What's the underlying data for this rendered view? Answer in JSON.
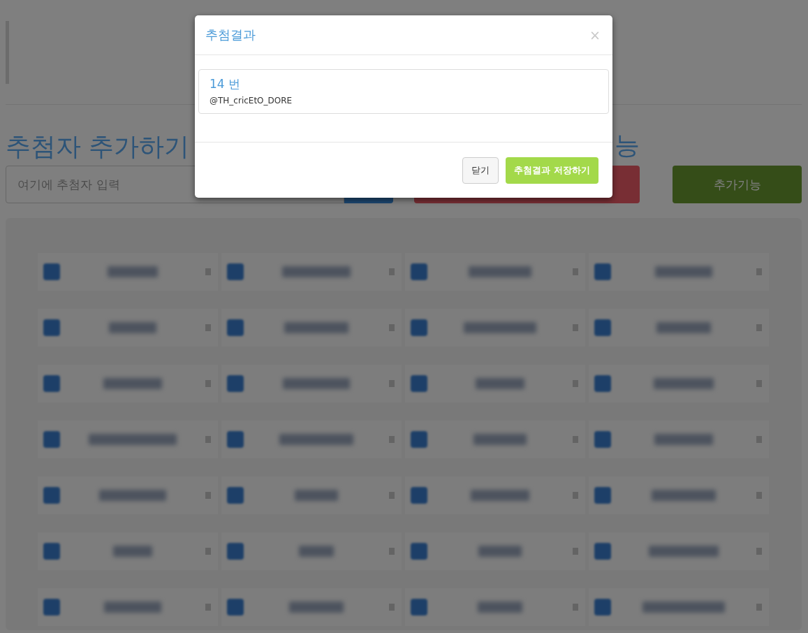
{
  "page": {
    "heading": "추첨자 추가하기",
    "heading_2": "능",
    "input": {
      "placeholder": "여기에 추첨자 입력"
    },
    "extra_button": "추가기능",
    "entries": [
      {
        "redacted": true
      },
      {
        "redacted": true
      },
      {
        "redacted": true
      },
      {
        "redacted": true
      },
      {
        "redacted": true
      },
      {
        "redacted": true
      },
      {
        "redacted": true
      },
      {
        "redacted": true
      },
      {
        "redacted": true
      },
      {
        "redacted": true
      },
      {
        "redacted": true
      },
      {
        "redacted": true
      },
      {
        "redacted": true
      },
      {
        "redacted": true
      },
      {
        "redacted": true
      },
      {
        "redacted": true
      },
      {
        "redacted": true
      },
      {
        "redacted": true
      },
      {
        "redacted": true
      },
      {
        "redacted": true
      },
      {
        "redacted": true
      },
      {
        "redacted": true
      },
      {
        "redacted": true
      },
      {
        "redacted": true
      },
      {
        "redacted": true
      },
      {
        "redacted": true
      },
      {
        "redacted": true
      },
      {
        "redacted": true
      }
    ]
  },
  "modal": {
    "title": "추첨결과",
    "close": "×",
    "result": {
      "number": "14 번",
      "handle": "@TH_cricEtO_DORE"
    },
    "buttons": [
      {
        "label": "닫기",
        "kind": "default"
      },
      {
        "label": "추첨결과 저장하기",
        "kind": "primary"
      }
    ]
  }
}
